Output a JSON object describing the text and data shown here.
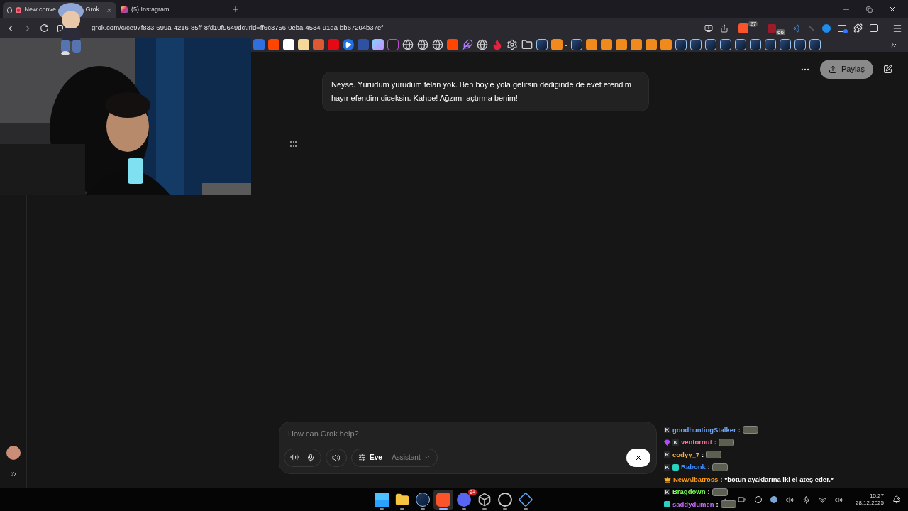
{
  "tabs": [
    {
      "title_start": "New conve",
      "title_end": "Grok",
      "selected": true,
      "kind": "grok"
    },
    {
      "title": "(5) Instagram",
      "selected": false,
      "kind": "instagram"
    }
  ],
  "address": "grok.com/c/ce97f833-699a-4216-85ff-8fd10f9649dc?rid=ff6c3756-0eba-4534-91da-bb67204b37ef",
  "shields_count": "27",
  "extension_count": "66",
  "bookmarks": [
    {
      "kind": "blue"
    },
    {
      "kind": "reddit"
    },
    {
      "kind": "p"
    },
    {
      "kind": "amazon"
    },
    {
      "kind": "duck"
    },
    {
      "kind": "netflix"
    },
    {
      "kind": "play"
    },
    {
      "kind": "mal"
    },
    {
      "kind": "orb"
    },
    {
      "kind": "km"
    },
    {
      "kind": "globe"
    },
    {
      "kind": "globe"
    },
    {
      "kind": "globe"
    },
    {
      "kind": "reddit"
    },
    {
      "kind": "feather"
    },
    {
      "kind": "globe"
    },
    {
      "kind": "flame"
    },
    {
      "kind": "gear"
    },
    {
      "kind": "folder"
    },
    {
      "kind": "steam"
    },
    {
      "kind": "orange",
      "label": "-"
    },
    {
      "kind": "steam"
    },
    {
      "kind": "orange"
    },
    {
      "kind": "orange"
    },
    {
      "kind": "orange"
    },
    {
      "kind": "orange"
    },
    {
      "kind": "orange"
    },
    {
      "kind": "orange"
    },
    {
      "kind": "steam"
    },
    {
      "kind": "steam"
    },
    {
      "kind": "steam"
    },
    {
      "kind": "steam"
    },
    {
      "kind": "steam"
    },
    {
      "kind": "steam"
    },
    {
      "kind": "steam"
    },
    {
      "kind": "steam"
    },
    {
      "kind": "steam"
    },
    {
      "kind": "steam"
    }
  ],
  "share_button": "Paylaş",
  "message": "Neyse. Yürüdüm yürüdüm felan yok. Ben böyle yola gelirsin dediğinde de evet efendim hayır efendim diceksin. Kahpe! Ağzımı açtırma benim!",
  "composer": {
    "placeholder": "How can Grok help?",
    "persona": "Eve",
    "separator": "·",
    "mode": "Assistant"
  },
  "chat": [
    {
      "name": "goodhuntingStalker",
      "color": "#6fa8ff",
      "badges": [
        {
          "kind": "kick",
          "text": "K"
        }
      ],
      "sep": ":",
      "emote": true
    },
    {
      "name": "ventorout",
      "color": "#ff6fa0",
      "badges": [
        {
          "kind": "gem"
        },
        {
          "kind": "kick",
          "text": "K"
        }
      ],
      "sep": ":",
      "emote": true
    },
    {
      "name": "codyy_7",
      "color": "#ffb13b",
      "badges": [
        {
          "kind": "kick",
          "text": "K"
        }
      ],
      "sep": ":",
      "emote": true
    },
    {
      "name": "Rabonk",
      "color": "#3f8cff",
      "badges": [
        {
          "kind": "kick",
          "text": "K"
        },
        {
          "kind": "sub"
        }
      ],
      "sep": ":",
      "emote": true
    },
    {
      "name": "NewAlbatross",
      "color": "#ff9c1a",
      "badges": [
        {
          "kind": "crown"
        }
      ],
      "sep": ":",
      "text": "*botun ayaklarına iki el ateş eder.*"
    },
    {
      "name": "Bragdown",
      "color": "#7dff5a",
      "badges": [
        {
          "kind": "kick",
          "text": "K"
        }
      ],
      "sep": ":",
      "emote": true
    },
    {
      "name": "saddydumen",
      "color": "#c56bff",
      "badges": [
        {
          "kind": "sub"
        }
      ],
      "sep": ":",
      "emote": true
    }
  ],
  "taskbar": [
    {
      "kind": "windows",
      "selected": false
    },
    {
      "kind": "folder",
      "selected": false
    },
    {
      "kind": "steam",
      "selected": false
    },
    {
      "kind": "brave",
      "selected": true
    },
    {
      "kind": "discord",
      "badge": "9+",
      "selected": false
    },
    {
      "kind": "cube",
      "selected": false
    },
    {
      "kind": "obs",
      "selected": false
    },
    {
      "kind": "app",
      "selected": false
    }
  ],
  "clock": {
    "time": "15:27",
    "date": "28.12.2025"
  }
}
